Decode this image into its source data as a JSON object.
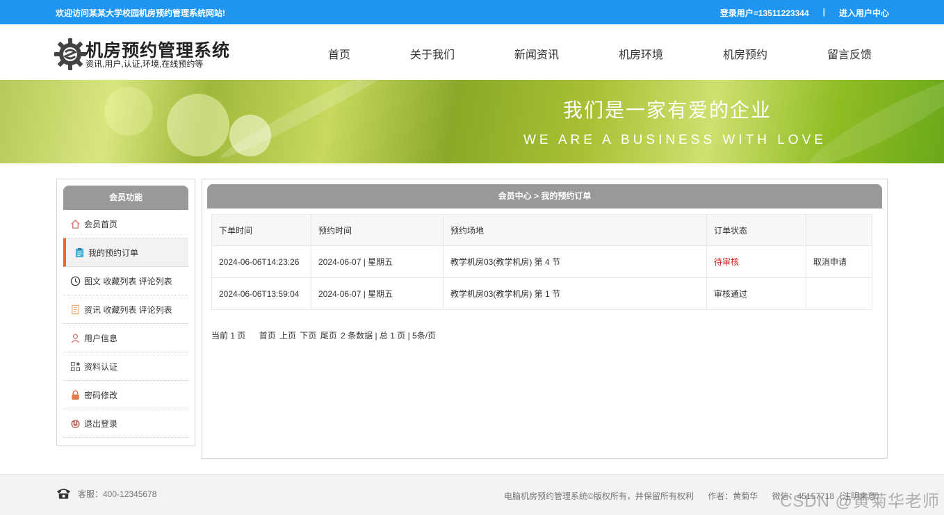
{
  "topbar": {
    "welcome": "欢迎访问某某大学校园机房预约管理系统网站!",
    "login_user": "登录用户=13511223344",
    "separator": "|",
    "user_center": "进入用户中心"
  },
  "header": {
    "logo_title": "机房预约管理系统",
    "logo_subtitle": "资讯,用户,认证,环境,在线预约等",
    "nav": [
      "首页",
      "关于我们",
      "新闻资讯",
      "机房环境",
      "机房预约",
      "留言反馈"
    ]
  },
  "banner": {
    "title_cn": "我们是一家有爱的企业",
    "title_en": "WE ARE A BUSINESS WITH LOVE"
  },
  "sidebar": {
    "title": "会员功能",
    "items": [
      {
        "label": "会员首页",
        "icon": "home-icon"
      },
      {
        "label": "我的预约订单",
        "icon": "clipboard-icon"
      },
      {
        "label": "图文 收藏列表 评论列表",
        "icon": "clock-icon"
      },
      {
        "label": "资讯 收藏列表 评论列表",
        "icon": "document-icon"
      },
      {
        "label": "用户信息",
        "icon": "user-icon"
      },
      {
        "label": "资料认证",
        "icon": "grid-icon"
      },
      {
        "label": "密码修改",
        "icon": "lock-icon"
      },
      {
        "label": "退出登录",
        "icon": "power-icon"
      }
    ],
    "active_index": 1
  },
  "main": {
    "breadcrumb": "会员中心 > 我的预约订单",
    "table": {
      "headers": [
        "下单时间",
        "预约时间",
        "预约场地",
        "订单状态",
        ""
      ],
      "rows": [
        {
          "order_time": "2024-06-06T14:23:26",
          "reserve_time": "2024-06-07 | 星期五",
          "venue": "教学机房03(教学机房) 第 4 节",
          "status": "待审核",
          "action": "取消申请"
        },
        {
          "order_time": "2024-06-06T13:59:04",
          "reserve_time": "2024-06-07 | 星期五",
          "venue": "教学机房03(教学机房) 第 1 节",
          "status": "审核通过",
          "action": ""
        }
      ]
    },
    "pager": {
      "current": "当前 1 页",
      "first": "首页",
      "prev": "上页",
      "next": "下页",
      "last": "尾页",
      "summary": "2 条数据 | 总 1 页 | 5条/页"
    }
  },
  "footer": {
    "service": "客服：400-12345678",
    "copyright": "电脑机房预约管理系统©版权所有，并保留所有权利",
    "author": "作者：黄菊华",
    "wechat": "微信：45157718（注明来意）"
  },
  "watermark": "CSDN @黄菊华老师",
  "colors": {
    "topbar": "#1e95f0",
    "panel_header": "#999999",
    "pending_status": "#d0211c",
    "active_marker": "#f26321"
  }
}
